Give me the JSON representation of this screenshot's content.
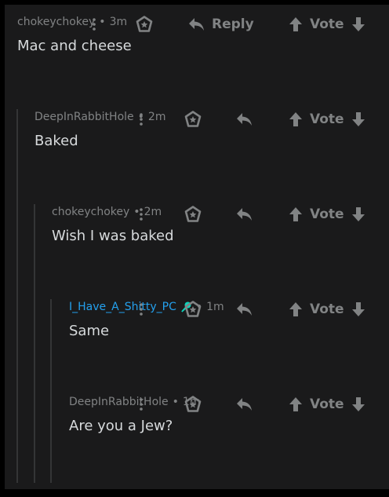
{
  "comments": [
    {
      "author": "chokeychokey",
      "separator": "•",
      "time": "3m",
      "text": "Mac and cheese",
      "show_reply_label": true
    },
    {
      "author": "DeepInRabbitHole",
      "separator": "•",
      "time": "2m",
      "text": "Baked",
      "show_reply_label": false
    },
    {
      "author": "chokeychokey",
      "separator": "•",
      "time": "2m",
      "text": "Wish I was baked",
      "show_reply_label": false
    },
    {
      "author": "I_Have_A_Shitty_PC",
      "separator": "•",
      "time": "1m",
      "text": "Same",
      "show_reply_label": false,
      "flair_icon": "microphone-icon"
    },
    {
      "author": "DeepInRabbitHole",
      "separator": "•",
      "time": "1m",
      "text": "Are you a Jew?",
      "show_reply_label": false
    }
  ],
  "actions": {
    "reply_label": "Reply",
    "vote_label": "Vote"
  },
  "colors": {
    "background": "#1a1a1b",
    "frame": "#000000",
    "meta_text": "#818384",
    "body_text": "#d7dadc",
    "flair_author": "#24a0ed",
    "flair_icon": "#0dd3bb",
    "thread_line": "#343536"
  },
  "icons": {
    "more": "more-options-icon",
    "award": "award-icon",
    "reply": "reply-arrow-icon",
    "upvote": "upvote-arrow-icon",
    "downvote": "downvote-arrow-icon"
  }
}
